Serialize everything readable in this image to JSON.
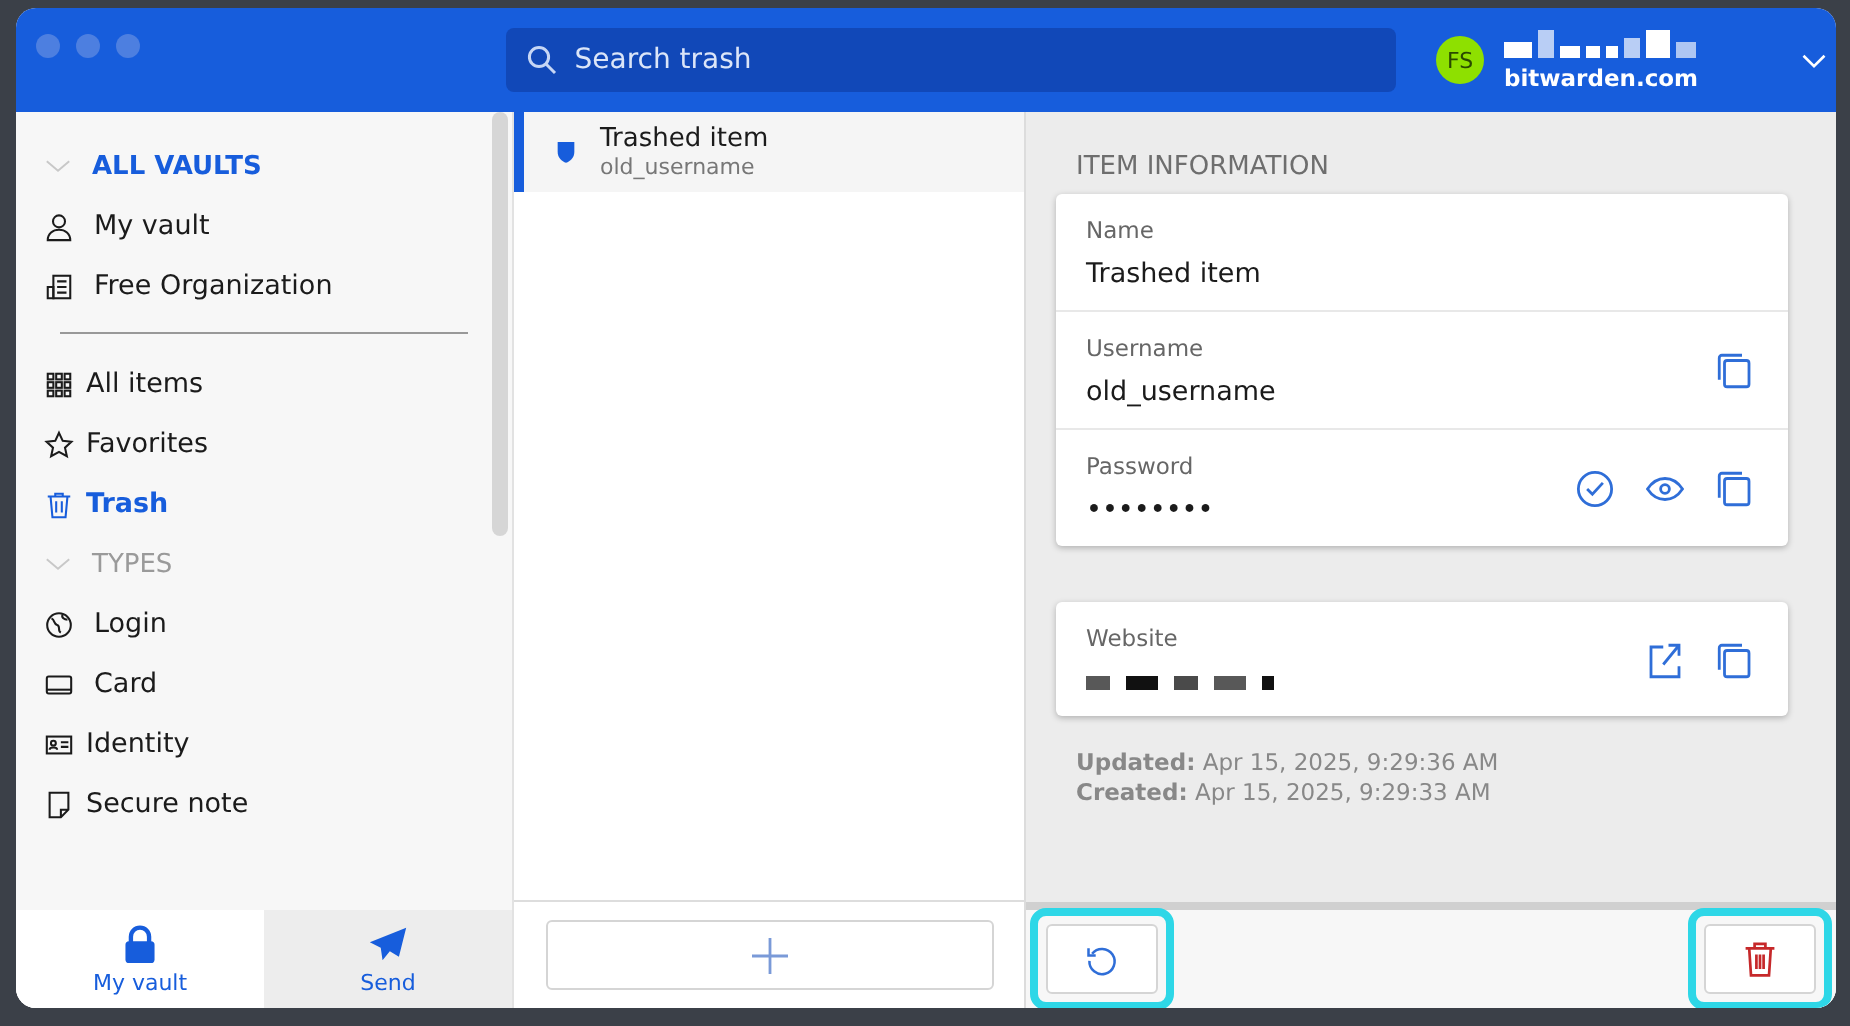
{
  "header": {
    "search": {
      "placeholder": "Search trash"
    },
    "account": {
      "initials": "FS",
      "server": "bitwarden.com"
    }
  },
  "sidebar": {
    "sections": [
      {
        "title": "ALL VAULTS",
        "expanded": true,
        "active": true,
        "items": [
          {
            "label": "My vault",
            "selected": false
          },
          {
            "label": "Free Organization",
            "selected": false
          }
        ]
      },
      {
        "items": [
          {
            "label": "All items",
            "selected": false
          },
          {
            "label": "Favorites",
            "selected": false
          },
          {
            "label": "Trash",
            "selected": true
          }
        ]
      },
      {
        "title": "TYPES",
        "expanded": true,
        "active": false,
        "items": [
          {
            "label": "Login",
            "selected": false
          },
          {
            "label": "Card",
            "selected": false
          },
          {
            "label": "Identity",
            "selected": false
          },
          {
            "label": "Secure note",
            "selected": false
          }
        ]
      }
    ],
    "nav": [
      {
        "label": "My vault",
        "selected": true
      },
      {
        "label": "Send",
        "selected": false
      }
    ]
  },
  "items": [
    {
      "name": "Trashed item",
      "subtitle": "old_username",
      "selected": true
    }
  ],
  "detail": {
    "heading": "ITEM INFORMATION",
    "cards": [
      [
        {
          "kind": "plain",
          "label": "Name",
          "value": "Trashed item"
        },
        {
          "kind": "copyable",
          "label": "Username",
          "value": "old_username"
        },
        {
          "kind": "secret",
          "label": "Password",
          "value": "••••••••"
        }
      ],
      [
        {
          "kind": "uri",
          "label": "Website"
        }
      ]
    ],
    "meta": [
      {
        "label": "Updated:",
        "value": "Apr 15, 2025, 9:29:36 AM"
      },
      {
        "label": "Created:",
        "value": "Apr 15, 2025, 9:29:33 AM"
      }
    ],
    "footer": [
      {
        "kind": "restore",
        "highlighted": true
      },
      {
        "kind": "delete",
        "highlighted": true
      }
    ]
  }
}
